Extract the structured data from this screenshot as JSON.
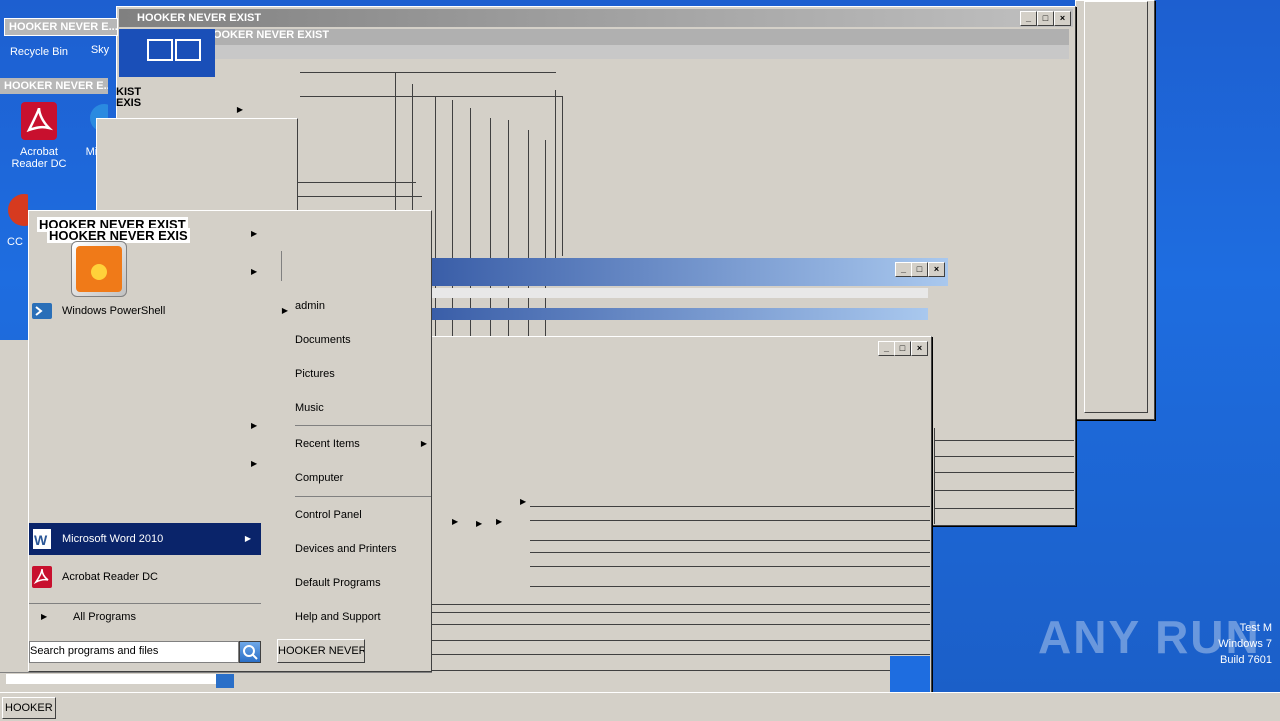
{
  "window_title": "HOOKER NEVER EXIST",
  "title_short_1": "HOOKER NEVER E...",
  "title_short_2": "HOOKER NEVER E...",
  "overlay_title_a": "HOOKER NEVER EXIST",
  "overlay_title_b": "HOOKER NEVER EXIS",
  "fragment_1": "KIST",
  "fragment_2": "EXIS",
  "desktop_icons": [
    {
      "label": "Recycle Bin",
      "icon": "recycle-bin-icon"
    },
    {
      "label": "Sky",
      "icon": "skype-icon"
    },
    {
      "label": "Acrobat Reader DC",
      "icon": "acrobat-icon"
    },
    {
      "label": "Micr",
      "icon": "edge-icon"
    },
    {
      "label": "CC",
      "icon": "ccleaner-icon"
    }
  ],
  "start_menu": {
    "left_items": [
      {
        "label": "Windows PowerShell",
        "icon": "powershell-icon",
        "has_arrow": true
      },
      {
        "label": "Microsoft Word 2010",
        "icon": "word-icon",
        "has_arrow": true,
        "selected": true
      },
      {
        "label": "Acrobat Reader DC",
        "icon": "acrobat-icon",
        "has_arrow": false
      }
    ],
    "all_programs": "All Programs",
    "search_placeholder": "Search programs and files",
    "shutdown_label": "HOOKER NEVER EXIS",
    "right_items": [
      {
        "label": "admin"
      },
      {
        "label": "Documents"
      },
      {
        "label": "Pictures"
      },
      {
        "label": "Music"
      },
      {
        "label": "Recent Items",
        "has_arrow": true
      },
      {
        "label": "Computer"
      },
      {
        "label": "Control Panel"
      },
      {
        "label": "Devices and Printers"
      },
      {
        "label": "Default Programs"
      },
      {
        "label": "Help and Support"
      }
    ]
  },
  "taskbar": {
    "button_label": "HOOKER NEVER"
  },
  "watermark": {
    "brand": "ANY RUN",
    "lines": [
      "Test M",
      "Windows 7",
      "Build 7601"
    ]
  },
  "colors": {
    "desktop": "#1e6de0",
    "window_face": "#d4d0c8",
    "selection": "#0a246a"
  }
}
